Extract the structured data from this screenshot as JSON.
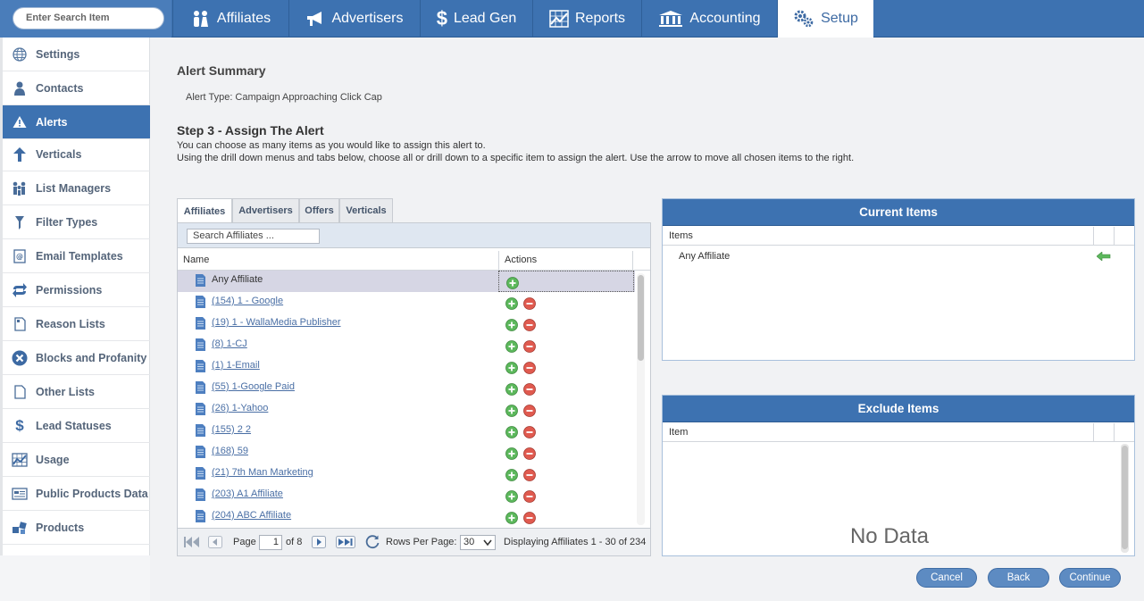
{
  "search": {
    "placeholder": "Enter Search Item"
  },
  "nav": {
    "tabs": [
      {
        "label": "Affiliates",
        "icon": "users-icon"
      },
      {
        "label": "Advertisers",
        "icon": "megaphone-icon"
      },
      {
        "label": "Lead Gen",
        "icon": "dollar-icon"
      },
      {
        "label": "Reports",
        "icon": "chart-icon"
      },
      {
        "label": "Accounting",
        "icon": "bank-icon"
      },
      {
        "label": "Setup",
        "icon": "gears-icon",
        "active": true
      }
    ]
  },
  "sidebar": {
    "items": [
      {
        "label": "Settings",
        "icon": "globe-icon"
      },
      {
        "label": "Contacts",
        "icon": "person-icon"
      },
      {
        "label": "Alerts",
        "icon": "warning-icon",
        "active": true
      },
      {
        "label": "Verticals",
        "icon": "arrow-up-icon"
      },
      {
        "label": "List Managers",
        "icon": "group-icon"
      },
      {
        "label": "Filter Types",
        "icon": "filter-icon"
      },
      {
        "label": "Email Templates",
        "icon": "email-template-icon"
      },
      {
        "label": "Permissions",
        "icon": "refresh-icon"
      },
      {
        "label": "Reason Lists",
        "icon": "document-icon"
      },
      {
        "label": "Blocks and Profanity",
        "icon": "block-icon"
      },
      {
        "label": "Other Lists",
        "icon": "page-icon"
      },
      {
        "label": "Lead Statuses",
        "icon": "dollar-icon"
      },
      {
        "label": "Usage",
        "icon": "chart-icon"
      },
      {
        "label": "Public Products Data",
        "icon": "card-icon"
      },
      {
        "label": "Products",
        "icon": "cubes-icon"
      }
    ]
  },
  "summary": {
    "title": "Alert Summary",
    "alert_type": "Alert Type: Campaign Approaching Click Cap"
  },
  "step": {
    "title": "Step 3 - Assign The Alert",
    "line1": "You can choose as many items as you would like to assign this alert to.",
    "line2": "Using the drill down menus and tabs below, choose all or drill down to a specific item to assign the alert. Use the arrow to move all chosen items to the right."
  },
  "tabs": [
    "Affiliates",
    "Advertisers",
    "Offers",
    "Verticals"
  ],
  "grid": {
    "search_placeholder": "Search Affiliates ...",
    "columns": [
      "Name",
      "Actions"
    ],
    "rows": [
      {
        "name": "Any Affiliate",
        "selected": true
      },
      {
        "name": "(154) 1 - Google"
      },
      {
        "name": "(19) 1 - WallaMedia Publisher"
      },
      {
        "name": "(8) 1-CJ"
      },
      {
        "name": "(1) 1-Email"
      },
      {
        "name": "(55) 1-Google Paid"
      },
      {
        "name": "(26) 1-Yahoo"
      },
      {
        "name": "(155) 2 2"
      },
      {
        "name": "(168) 59"
      },
      {
        "name": "(21) 7th Man Marketing"
      },
      {
        "name": "(203) A1 Affiliate"
      },
      {
        "name": "(204) ABC Affiliate"
      }
    ],
    "footer": {
      "page_label": "Page",
      "page_value": "1",
      "of_label": "of 8",
      "rows_label": "Rows Per Page:",
      "rows_value": "30",
      "display_text": "Displaying Affiliates 1 - 30 of 234"
    }
  },
  "current_items": {
    "title": "Current Items",
    "column": "Items",
    "rows": [
      "Any Affiliate"
    ]
  },
  "exclude_items": {
    "title": "Exclude Items",
    "column": "Item",
    "empty": "No Data"
  },
  "buttons": {
    "cancel": "Cancel",
    "back": "Back",
    "continue": "Continue"
  },
  "colors": {
    "brand": "#3d72b1",
    "active_tab_text": "#3d6aa3",
    "add": "#5cb85c",
    "remove": "#d9534f"
  }
}
